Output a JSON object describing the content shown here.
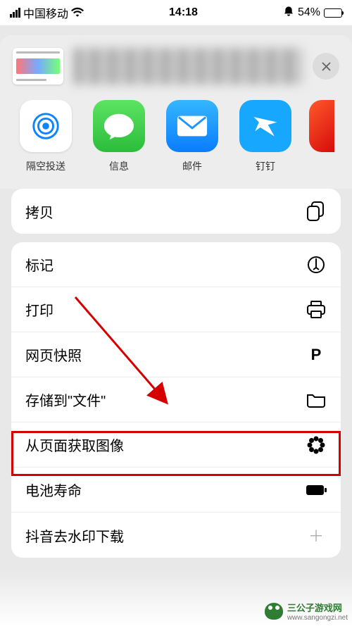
{
  "status": {
    "carrier": "中国移动",
    "time": "14:18",
    "battery_pct": "54%"
  },
  "share_apps": [
    {
      "id": "airdrop",
      "label": "隔空投送"
    },
    {
      "id": "messages",
      "label": "信息"
    },
    {
      "id": "mail",
      "label": "邮件"
    },
    {
      "id": "dingtalk",
      "label": "钉钉"
    }
  ],
  "groups": [
    {
      "rows": [
        {
          "id": "copy",
          "label": "拷贝",
          "icon": "copy-icon"
        }
      ]
    },
    {
      "rows": [
        {
          "id": "markup",
          "label": "标记",
          "icon": "markup-icon"
        },
        {
          "id": "print",
          "label": "打印",
          "icon": "print-icon"
        },
        {
          "id": "websnap",
          "label": "网页快照",
          "icon": "pocket-icon"
        },
        {
          "id": "save-files",
          "label": "存储到\"文件\"",
          "icon": "folder-icon",
          "highlighted": true
        },
        {
          "id": "get-images",
          "label": "从页面获取图像",
          "icon": "flower-icon"
        },
        {
          "id": "battery-life",
          "label": "电池寿命",
          "icon": "battery-icon"
        },
        {
          "id": "douyin-dl",
          "label": "抖音去水印下载",
          "icon": "plus-icon"
        }
      ]
    }
  ],
  "watermark": {
    "brand": "三公子游戏网",
    "url": "www.sangongzi.net"
  }
}
